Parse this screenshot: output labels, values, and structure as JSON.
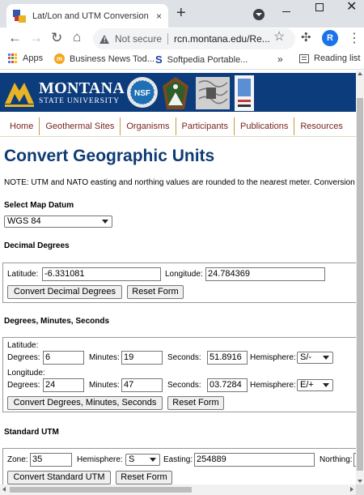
{
  "browser": {
    "tab_title": "Lat/Lon and UTM Conversion - Y",
    "tab_close": "×",
    "new_tab": "+",
    "not_secure": "Not secure",
    "url": "rcn.montana.edu/Re...",
    "profile_initial": "R",
    "bookmarks": {
      "apps": "Apps",
      "business_news": "Business News Tod...",
      "softpedia": "Softpedia Portable...",
      "more": "»",
      "reading_list": "Reading list"
    }
  },
  "banner": {
    "university_name": "MONTANA",
    "university_sub": "STATE UNIVERSITY",
    "nsf_text": "NSF"
  },
  "nav": {
    "items": [
      "Home",
      "Geothermal Sites",
      "Organisms",
      "Participants",
      "Publications",
      "Resources"
    ]
  },
  "page": {
    "title": "Convert Geographic Units",
    "note": "NOTE: UTM and NATO easting and northing values are rounded to the nearest meter. Conversion"
  },
  "datum": {
    "label": "Select Map Datum",
    "value": "WGS 84"
  },
  "decimal": {
    "heading": "Decimal Degrees",
    "lat_label": "Latitude:",
    "lat_value": "-6.331081",
    "lon_label": "Longitude:",
    "lon_value": "24.784369",
    "convert_button": "Convert Decimal Degrees",
    "reset_button": "Reset Form"
  },
  "dms": {
    "heading": "Degrees, Minutes, Seconds",
    "lat_label": "Latitude:",
    "lon_label": "Longitude:",
    "degrees_label": "Degrees:",
    "minutes_label": "Minutes:",
    "seconds_label": "Seconds:",
    "hemisphere_label": "Hemisphere:",
    "lat_degrees": "6",
    "lat_minutes": "19",
    "lat_seconds": "51.8916",
    "lat_hemisphere": "S/-",
    "lon_degrees": "24",
    "lon_minutes": "47",
    "lon_seconds": "03.7284",
    "lon_hemisphere": "E/+",
    "convert_button": "Convert Degrees, Minutes, Seconds",
    "reset_button": "Reset Form"
  },
  "utm": {
    "heading": "Standard UTM",
    "zone_label": "Zone:",
    "zone_value": "35",
    "hemisphere_label": "Hemisphere:",
    "hemisphere_value": "S",
    "easting_label": "Easting:",
    "easting_value": "254889",
    "northing_label": "Northing:",
    "convert_button": "Convert Standard UTM",
    "reset_button": "Reset Form"
  },
  "colors": {
    "banner_blue": "#0d3c7c",
    "title_blue": "#0e3b73",
    "nav_text": "#7a1f1f",
    "nav_divider": "#c99a44"
  }
}
